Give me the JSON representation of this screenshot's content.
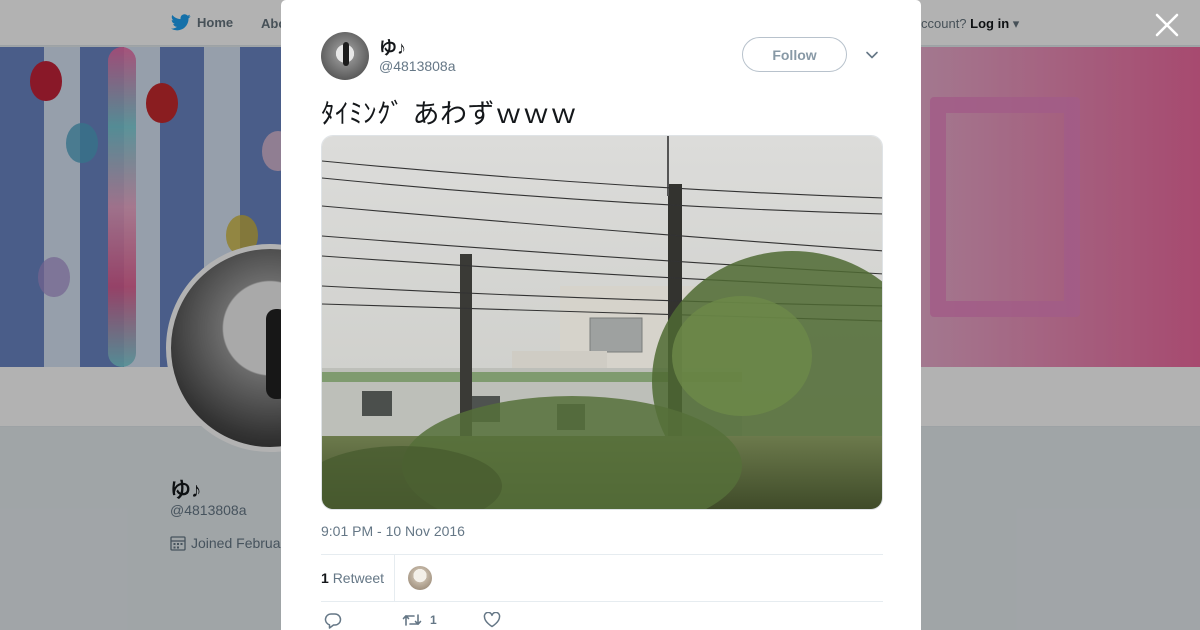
{
  "nav": {
    "home_label": "Home",
    "about_label": "Abo",
    "account_prompt": "ccount?",
    "login_label": "Log in"
  },
  "profile": {
    "name": "ゆ♪",
    "handle": "@4813808a",
    "joined": "Joined Februa"
  },
  "tweet": {
    "author_name": "ゆ♪",
    "author_handle": "@4813808a",
    "follow_label": "Follow",
    "text": "ﾀｲﾐﾝｸﾞ あわずｗｗｗ",
    "timestamp": "9:01 PM - 10 Nov 2016",
    "retweet_count": "1",
    "retweet_label": "Retweet",
    "action_retweet_count": "1"
  },
  "colors": {
    "brand_blue": "#1da1f2",
    "muted_text": "#657786",
    "follow_border": "#b8c2cc"
  },
  "icons": {
    "nav": "twitter-bird-icon",
    "close": "close-icon",
    "caret": "chevron-down-icon",
    "joined": "calendar-icon",
    "reply": "reply-icon",
    "retweet": "retweet-icon",
    "like": "heart-icon"
  }
}
